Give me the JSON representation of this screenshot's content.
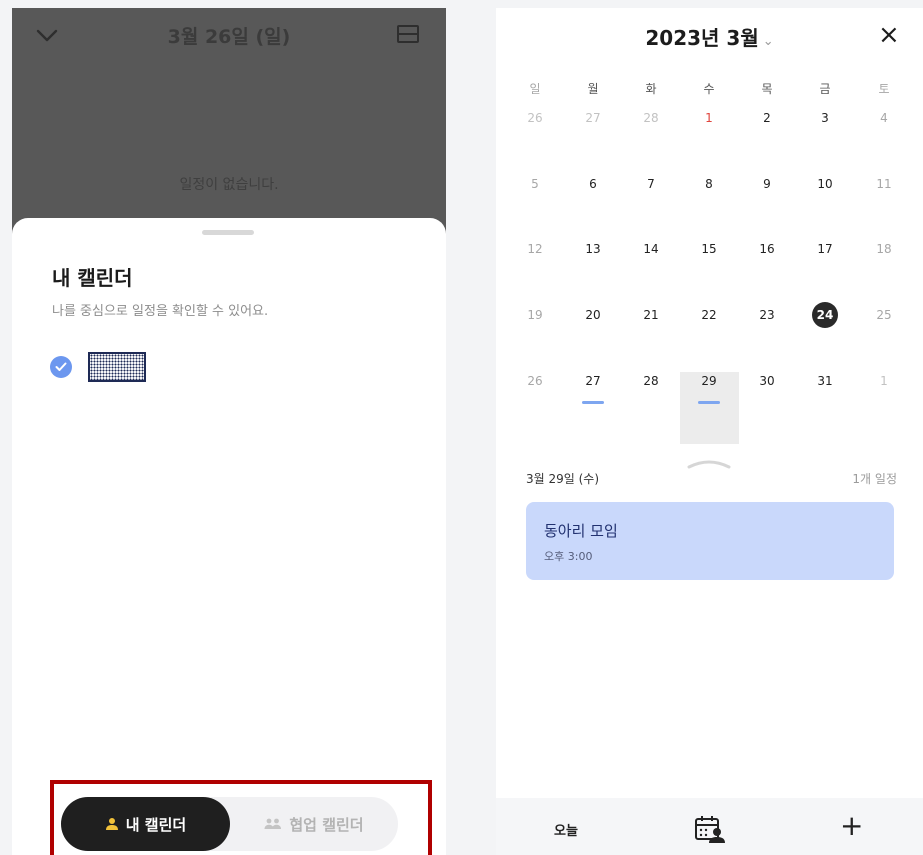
{
  "left_panel": {
    "header_date": "3월 26일 (일)",
    "empty_message": "일정이 없습니다.",
    "sheet": {
      "title": "내 캘린더",
      "subtitle": "나를 중심으로 일정을 확인할 수 있어요.",
      "calendar_checked": true
    },
    "segment": {
      "my_calendar": "내 캘린더",
      "shared_calendar": "협업 캘린더",
      "selected": "my_calendar"
    }
  },
  "right_panel": {
    "month_title": "2023년 3월",
    "caret": "⌄",
    "close_icon": "×",
    "weekdays": [
      "일",
      "월",
      "화",
      "수",
      "목",
      "금",
      "토"
    ],
    "weeks": [
      [
        "26",
        "27",
        "28",
        "1",
        "2",
        "3",
        "4"
      ],
      [
        "5",
        "6",
        "7",
        "8",
        "9",
        "10",
        "11"
      ],
      [
        "12",
        "13",
        "14",
        "15",
        "16",
        "17",
        "18"
      ],
      [
        "19",
        "20",
        "21",
        "22",
        "23",
        "24",
        "25"
      ],
      [
        "26",
        "27",
        "28",
        "29",
        "30",
        "31",
        "1"
      ]
    ],
    "today": "24",
    "selected_day": "29",
    "days_with_events": [
      "27",
      "29"
    ],
    "selected_date_label": "3월 29일 (수)",
    "event_count_label": "1개 일정",
    "event": {
      "title": "동아리 모임",
      "time": "오후 3:00",
      "color": "#c9d8fb"
    },
    "tabbar": {
      "today": "오늘",
      "add_icon": "+"
    }
  },
  "colors": {
    "accent_blue": "#6c97ef",
    "highlight_red": "#b00000",
    "holiday_red": "#e0453d",
    "person_yellow": "#f2c23a"
  }
}
